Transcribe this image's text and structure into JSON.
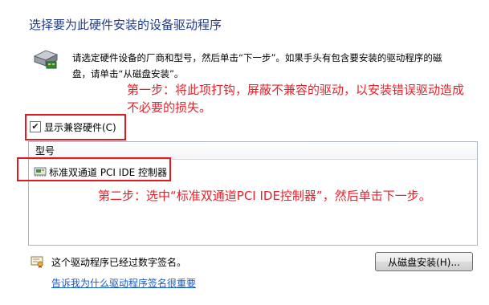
{
  "header": {
    "title": "选择要为此硬件安装的设备驱动程序"
  },
  "description": {
    "line1": "请选定硬件设备的厂商和型号，然后单击“下一步”。如果手头有包含要安装的驱动程序的磁",
    "line2": "盘，请单击“从磁盘安装”。"
  },
  "annotations": {
    "step1_line1": "第一步：将此项打钩，屏蔽不兼容的驱动，以安装错误驱动造成",
    "step1_line2": "不必要的损失。",
    "step2": "第二步：选中“标准双通道PCI IDE控制器”，然后单击下一步。",
    "color": "#e8202a"
  },
  "compat_checkbox": {
    "label": "显示兼容硬件(C)",
    "checked": true,
    "check_glyph": "✔"
  },
  "model_list": {
    "header": "型号",
    "items": [
      {
        "label": "标准双通道 PCI IDE 控制器",
        "icon": "controller-icon"
      }
    ]
  },
  "footer": {
    "signature_text": "这个驱动程序已经过数字签名。",
    "signature_icon": "certificate-icon",
    "link_text": "告诉我为什么驱动程序签名很重要",
    "disk_button": "从磁盘安装(H)..."
  },
  "colors": {
    "title": "#1e3b8c",
    "link": "#1a5bc4",
    "highlight_border": "#e01a22"
  }
}
